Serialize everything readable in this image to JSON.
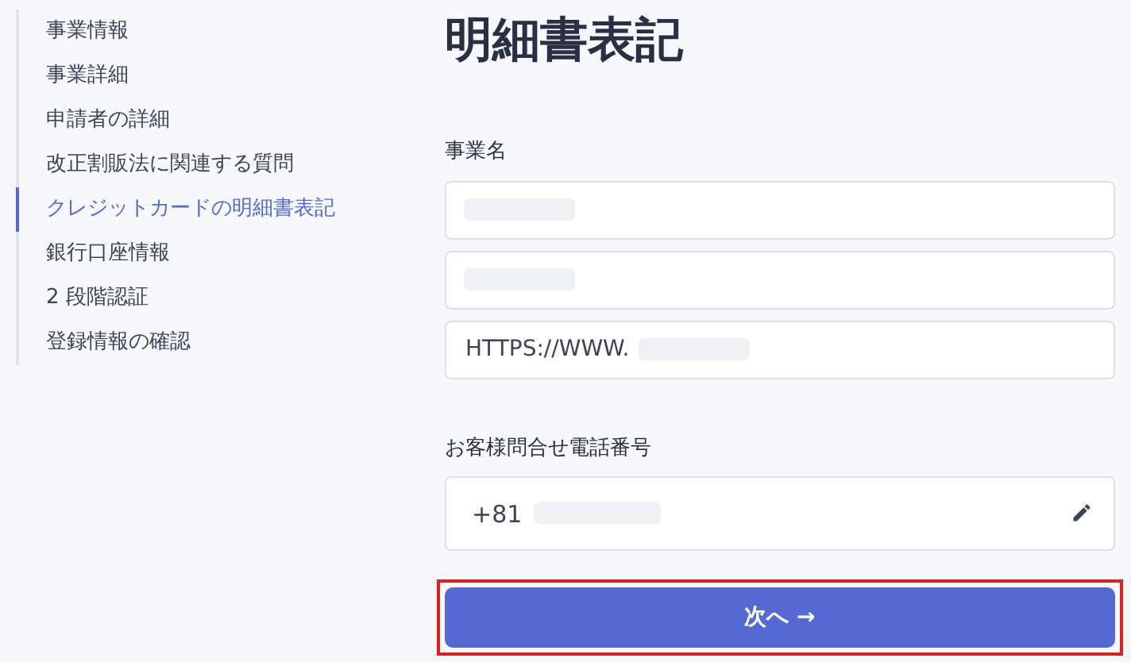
{
  "sidebar": {
    "items": [
      {
        "label": "事業情報",
        "selected": false
      },
      {
        "label": "事業詳細",
        "selected": false
      },
      {
        "label": "申請者の詳細",
        "selected": false
      },
      {
        "label": "改正割販法に関連する質問",
        "selected": false
      },
      {
        "label": "クレジットカードの明細書表記",
        "selected": true
      },
      {
        "label": "銀行口座情報",
        "selected": false
      },
      {
        "label": "2 段階認証",
        "selected": false
      },
      {
        "label": "登録情報の確認",
        "selected": false
      }
    ]
  },
  "title": "明細書表記",
  "business_name": {
    "label": "事業名",
    "fields": [
      {
        "redacted": true
      },
      {
        "redacted": true
      },
      {
        "value": "HTTPS://WWW.",
        "redacted": true
      }
    ]
  },
  "phone": {
    "label": "お客様問合せ電話番号",
    "value": "+81",
    "editable": true,
    "redacted": true
  },
  "next_button": {
    "label": "次へ →",
    "highlighted": true
  }
}
